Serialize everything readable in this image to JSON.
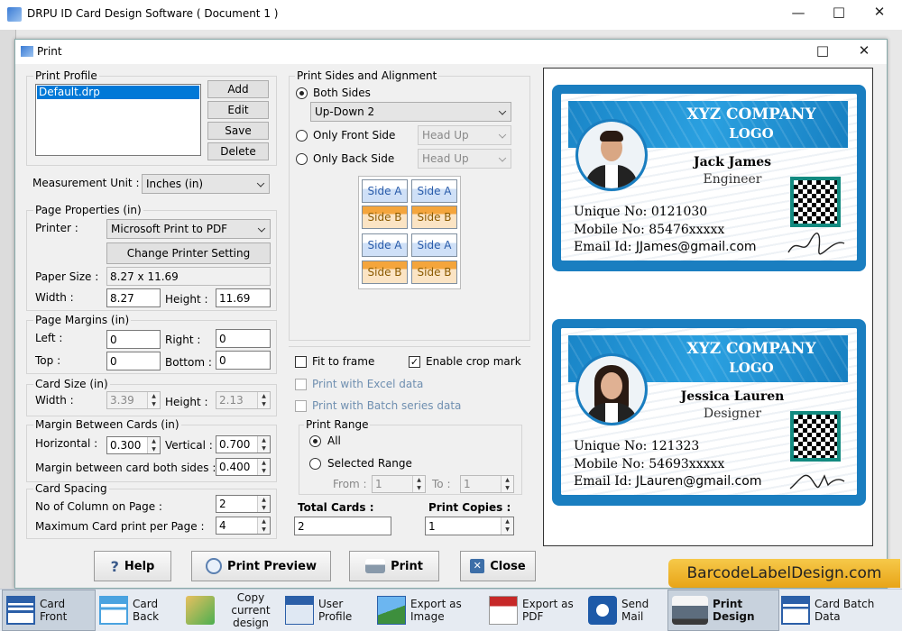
{
  "app": {
    "title": "DRPU ID Card Design Software ( Document 1 )"
  },
  "dialog": {
    "title": "Print"
  },
  "print_profile": {
    "label": "Print Profile",
    "items": [
      "Default.drp"
    ],
    "selected": "Default.drp",
    "add": "Add",
    "edit": "Edit",
    "save": "Save",
    "delete": "Delete"
  },
  "measurement": {
    "label": "Measurement Unit :",
    "value": "Inches (in)"
  },
  "page_properties": {
    "label": "Page Properties (in)",
    "printer_label": "Printer :",
    "printer": "Microsoft Print to PDF",
    "change": "Change Printer Setting",
    "paper_label": "Paper Size :",
    "paper": "8.27 x 11.69",
    "width_label": "Width :",
    "width": "8.27",
    "height_label": "Height :",
    "height": "11.69"
  },
  "margins": {
    "label": "Page Margins (in)",
    "left_label": "Left :",
    "left": "0",
    "right_label": "Right :",
    "right": "0",
    "top_label": "Top :",
    "top": "0",
    "bottom_label": "Bottom :",
    "bottom": "0"
  },
  "card_size": {
    "label": "Card Size (in)",
    "width_label": "Width :",
    "width": "3.39",
    "height_label": "Height :",
    "height": "2.13"
  },
  "margin_between": {
    "label": "Margin Between Cards (in)",
    "horizontal_label": "Horizontal :",
    "horizontal": "0.300",
    "vertical_label": "Vertical :",
    "vertical": "0.700",
    "both_label": "Margin between card both sides :",
    "both": "0.400"
  },
  "spacing": {
    "label": "Card Spacing",
    "columns_label": "No of Column on Page :",
    "columns": "2",
    "max_label": "Maximum Card print per Page :",
    "max": "4"
  },
  "sides": {
    "label": "Print Sides and Alignment",
    "both": "Both Sides",
    "both_mode": "Up-Down 2",
    "front": "Only Front Side",
    "front_mode": "Head Up",
    "back": "Only Back Side",
    "back_mode": "Head Up",
    "grid": [
      [
        "Side A",
        "Side A"
      ],
      [
        "Side B",
        "Side B"
      ],
      [
        "Side A",
        "Side A"
      ],
      [
        "Side B",
        "Side B"
      ]
    ]
  },
  "options": {
    "fit": "Fit to frame",
    "crop": "Enable crop mark",
    "excel": "Print with Excel data",
    "batch": "Print with Batch series data"
  },
  "range": {
    "label": "Print Range",
    "all": "All",
    "selected": "Selected Range",
    "from_label": "From :",
    "from": "1",
    "to_label": "To :",
    "to": "1"
  },
  "totals": {
    "cards_label": "Total Cards :",
    "cards": "2",
    "copies_label": "Print Copies :",
    "copies": "1"
  },
  "buttons": {
    "help": "Help",
    "preview": "Print Preview",
    "print": "Print",
    "close": "Close"
  },
  "cards": [
    {
      "company": "XYZ COMPANY",
      "logo": "LOGO",
      "name": "Jack James",
      "designation": "Engineer",
      "unique": "Unique No: 0121030",
      "mobile": "Mobile No: 85476xxxxx",
      "email_label": "Email Id: ",
      "email": "JJames@gmail.com"
    },
    {
      "company": "XYZ COMPANY",
      "logo": "LOGO",
      "name": "Jessica Lauren",
      "designation": "Designer",
      "unique": "Unique No: 121323",
      "mobile": "Mobile No: 54693xxxxx",
      "email_label": "Email Id: ",
      "email": "JLauren@gmail.com"
    }
  ],
  "brand": "BarcodeLabelDesign.com",
  "taskbar": [
    {
      "label": "Card Front"
    },
    {
      "label": "Card Back"
    },
    {
      "label": "Copy current design"
    },
    {
      "label": "User Profile"
    },
    {
      "label": "Export as Image"
    },
    {
      "label": "Export as PDF"
    },
    {
      "label": "Send Mail"
    },
    {
      "label": "Print Design"
    },
    {
      "label": "Card Batch Data"
    }
  ],
  "colors": {
    "card_blue": "#1a7ec0",
    "qr_frame": "#138a80",
    "brand_gold": "#e8a417"
  }
}
